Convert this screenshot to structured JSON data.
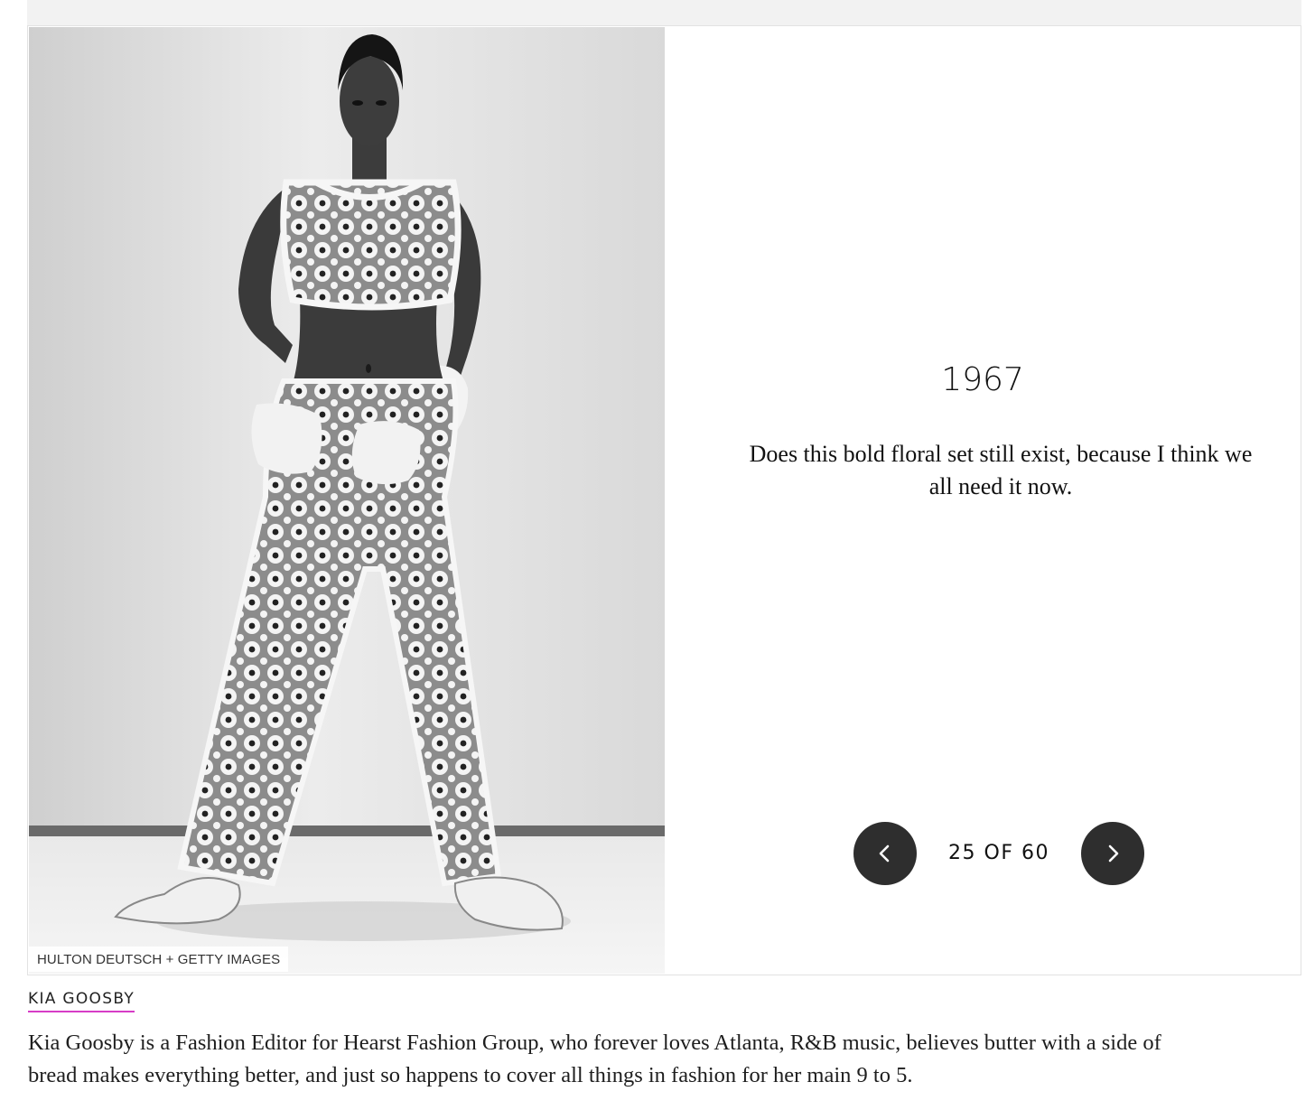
{
  "gallery": {
    "photo_alt": "Model wearing floral crop top and matching trousers, 1967",
    "photo_credit": "HULTON DEUTSCH + GETTY IMAGES",
    "slide_title": "1967",
    "slide_caption": "Does this bold floral set still exist, because I think we all need it now.",
    "counter": "25 OF 60",
    "prev_icon": "chevron-left-icon",
    "next_icon": "chevron-right-icon",
    "colors": {
      "nav_button": "#2e2e2e",
      "author_underline": "#d63cc6"
    }
  },
  "author": {
    "name": "KIA GOOSBY",
    "bio": "Kia Goosby is a Fashion Editor for Hearst Fashion Group, who forever loves Atlanta, R&B music, believes butter with a side of bread makes everything better, and just so happens to cover all things in fashion for her main 9 to 5."
  }
}
